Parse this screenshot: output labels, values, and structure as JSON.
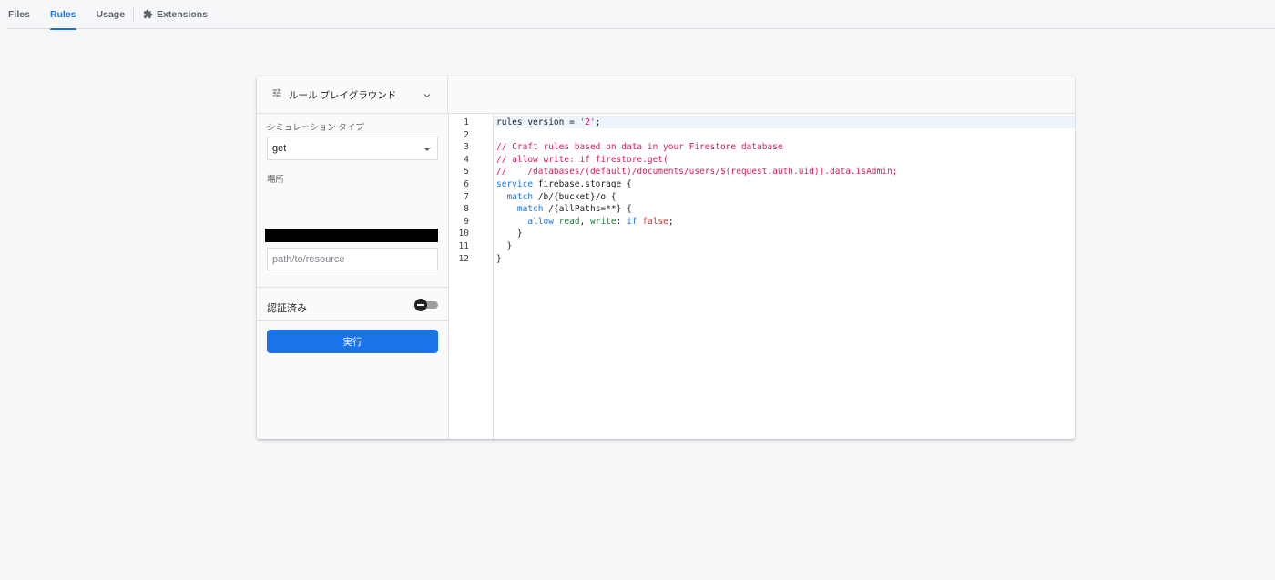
{
  "tabs": [
    {
      "label": "Files",
      "active": false
    },
    {
      "label": "Rules",
      "active": true
    },
    {
      "label": "Usage",
      "active": false
    }
  ],
  "extensions_tab": {
    "label": "Extensions",
    "icon": "extension-puzzle-icon"
  },
  "playground": {
    "title": "ルール プレイグラウンド",
    "tune_icon": "tune-icon",
    "collapse_icon": "chevron-down-icon",
    "simulation_type_label": "シミュレーション タイプ",
    "simulation_type_value": "get",
    "location_label": "場所",
    "path_placeholder": "path/to/resource",
    "authenticated_label": "認証済み",
    "authenticated": false,
    "run_label": "実行"
  },
  "editor": {
    "line_numbers": [
      "1",
      "2",
      "3",
      "4",
      "5",
      "6",
      "7",
      "8",
      "9",
      "10",
      "11",
      "12"
    ],
    "lines": [
      "rules_version = '2';",
      "",
      "// Craft rules based on data in your Firestore database",
      "// allow write: if firestore.get(",
      "//    /databases/(default)/documents/users/$(request.auth.uid)).data.isAdmin;",
      "service firebase.storage {",
      "  match /b/{bucket}/o {",
      "    match /{allPaths=**} {",
      "      allow read, write: if false;",
      "    }",
      "  }",
      "}"
    ]
  },
  "colors": {
    "accent": "#1a73e8",
    "comment": "#d81b60",
    "keyword": "#1a73e8",
    "permission": "#188038",
    "false_literal": "#d93025"
  }
}
